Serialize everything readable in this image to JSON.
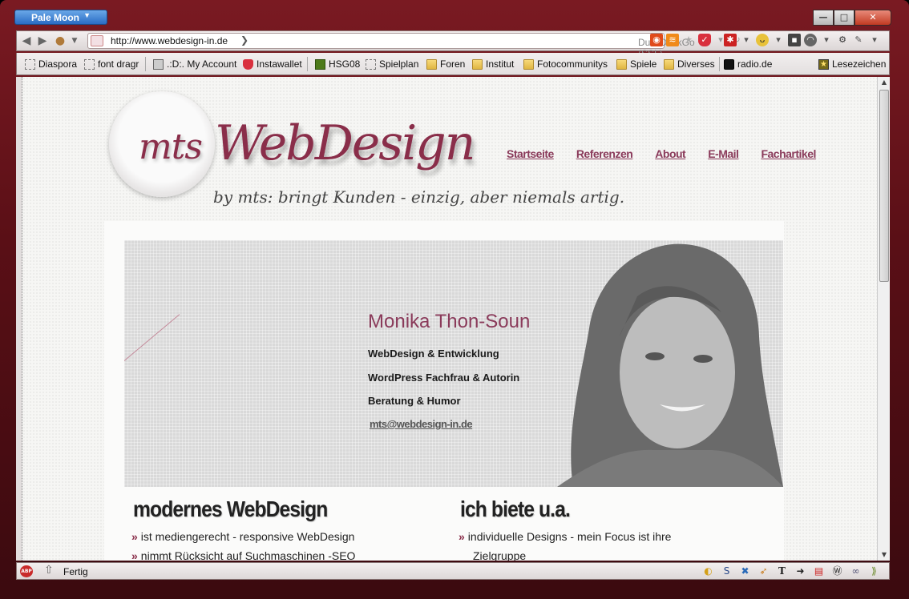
{
  "browser": {
    "app_menu": "Pale Moon",
    "url": "http://www.webdesign-in.de",
    "search_engine": "DuckDuckGo (SSL)",
    "status": "Fertig"
  },
  "bookmarks": [
    {
      "label": "Diaspora",
      "icon": "dashed-box-icon"
    },
    {
      "label": "font dragr",
      "icon": "dashed-box-icon"
    },
    {
      "label": ".:D:. My Account",
      "icon": "avatar-icon"
    },
    {
      "label": "Instawallet",
      "icon": "pocket-icon"
    },
    {
      "label": "HSG08",
      "icon": "green-square-icon"
    },
    {
      "label": "Spielplan",
      "icon": "dashed-box-icon"
    },
    {
      "label": "Foren",
      "icon": "folder-icon"
    },
    {
      "label": "Institut",
      "icon": "folder-icon"
    },
    {
      "label": "Fotocommunitys",
      "icon": "folder-icon"
    },
    {
      "label": "Spiele",
      "icon": "folder-icon"
    },
    {
      "label": "Diverses",
      "icon": "folder-icon"
    },
    {
      "label": "radio.de",
      "icon": "radio-icon"
    },
    {
      "label": "Lesezeichen",
      "icon": "bookmark-star-icon"
    }
  ],
  "site": {
    "logo_mts": "mts",
    "logo_webdesign": "WebDesign",
    "tagline": "by mts: bringt Kunden - einzig, aber niemals artig.",
    "nav": [
      "Startseite",
      "Referenzen",
      "About",
      "E-Mail",
      "Fachartikel"
    ],
    "hero": {
      "name": "Monika Thon-Soun",
      "line1": "WebDesign & Entwicklung",
      "line2": "WordPress Fachfrau & Autorin",
      "line3": "Beratung & Humor",
      "email": "mts@webdesign-in.de"
    },
    "col1": {
      "heading": "modernes WebDesign",
      "items": [
        "ist mediengerecht - responsive WebDesign",
        "nimmt Rücksicht auf Suchmaschinen -SEO"
      ]
    },
    "col2": {
      "heading": "ich biete u.a.",
      "items": [
        "individuelle Designs - mein Focus ist ihre",
        "Zielgruppe"
      ]
    }
  },
  "colors": {
    "accent": "#8a2e4a",
    "frame": "#5a0f16"
  }
}
